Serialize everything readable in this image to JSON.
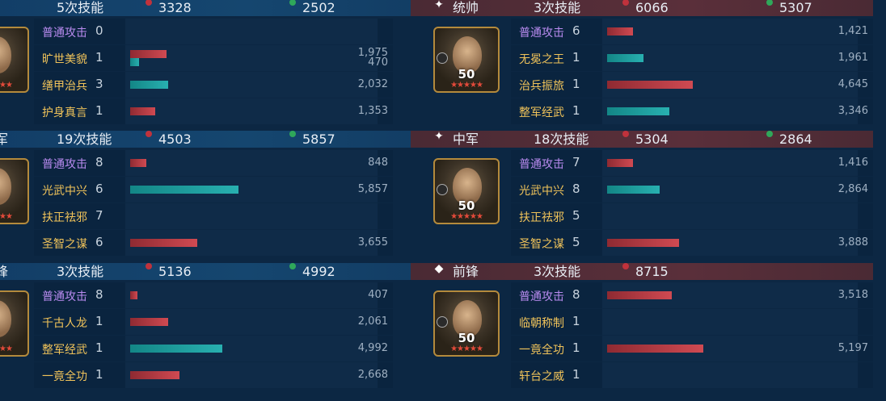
{
  "panels": [
    {
      "id": "left-1",
      "header_style": "blue",
      "position": "",
      "position_icon": "",
      "skill_count": "5次技能",
      "red_total": "3328",
      "green_total": "2502",
      "level": "",
      "skills": [
        {
          "name": "普通攻击",
          "count": "0",
          "kind": "purple",
          "red": null,
          "teal": null
        },
        {
          "name": "旷世美貌",
          "count": "1",
          "kind": "gold",
          "red": "1,975",
          "teal": "470",
          "red_frac": 0.15,
          "teal_frac": 0.036
        },
        {
          "name": "缮甲治兵",
          "count": "3",
          "kind": "gold",
          "red": null,
          "teal": "2,032",
          "teal_frac": 0.155
        },
        {
          "name": "护身真言",
          "count": "1",
          "kind": "gold",
          "red": "1,353",
          "teal": null,
          "red_frac": 0.103
        }
      ]
    },
    {
      "id": "left-2",
      "header_style": "blue",
      "position": "军",
      "position_icon": "",
      "skill_count": "19次技能",
      "red_total": "4503",
      "green_total": "5857",
      "level": "",
      "skills": [
        {
          "name": "普通攻击",
          "count": "8",
          "kind": "purple",
          "red": "848",
          "teal": null,
          "red_frac": 0.065
        },
        {
          "name": "光武中兴",
          "count": "6",
          "kind": "gold",
          "red": null,
          "teal": "5,857",
          "teal_frac": 0.446
        },
        {
          "name": "扶正祛邪",
          "count": "7",
          "kind": "gold",
          "red": null,
          "teal": null
        },
        {
          "name": "圣智之谋",
          "count": "6",
          "kind": "gold",
          "red": "3,655",
          "teal": null,
          "red_frac": 0.278
        }
      ]
    },
    {
      "id": "left-3",
      "header_style": "blue",
      "position": "锋",
      "position_icon": "",
      "skill_count": "3次技能",
      "red_total": "5136",
      "green_total": "4992",
      "level": "",
      "skills": [
        {
          "name": "普通攻击",
          "count": "8",
          "kind": "purple",
          "red": "407",
          "teal": null,
          "red_frac": 0.031
        },
        {
          "name": "千古人龙",
          "count": "1",
          "kind": "gold",
          "red": "2,061",
          "teal": null,
          "red_frac": 0.157
        },
        {
          "name": "整军经武",
          "count": "1",
          "kind": "gold",
          "red": null,
          "teal": "4,992",
          "teal_frac": 0.38
        },
        {
          "name": "一竟全功",
          "count": "1",
          "kind": "gold",
          "red": "2,668",
          "teal": null,
          "red_frac": 0.203
        }
      ]
    },
    {
      "id": "right-1",
      "header_style": "red",
      "position": "统帅",
      "position_icon": "✦",
      "skill_count": "3次技能",
      "red_total": "6066",
      "green_total": "5307",
      "level": "50",
      "skills": [
        {
          "name": "普通攻击",
          "count": "6",
          "kind": "purple",
          "red": "1,421",
          "teal": null,
          "red_frac": 0.108
        },
        {
          "name": "无冕之王",
          "count": "1",
          "kind": "gold",
          "red": null,
          "teal": "1,961",
          "teal_frac": 0.149
        },
        {
          "name": "治兵振旅",
          "count": "1",
          "kind": "gold",
          "red": "4,645",
          "teal": null,
          "red_frac": 0.354
        },
        {
          "name": "整军经武",
          "count": "1",
          "kind": "gold",
          "red": null,
          "teal": "3,346",
          "teal_frac": 0.255
        }
      ]
    },
    {
      "id": "right-2",
      "header_style": "red",
      "position": "中军",
      "position_icon": "✦",
      "skill_count": "18次技能",
      "red_total": "5304",
      "green_total": "2864",
      "level": "50",
      "skills": [
        {
          "name": "普通攻击",
          "count": "7",
          "kind": "purple",
          "red": "1,416",
          "teal": null,
          "red_frac": 0.108
        },
        {
          "name": "光武中兴",
          "count": "8",
          "kind": "gold",
          "red": null,
          "teal": "2,864",
          "teal_frac": 0.218
        },
        {
          "name": "扶正祛邪",
          "count": "5",
          "kind": "gold",
          "red": null,
          "teal": null
        },
        {
          "name": "圣智之谋",
          "count": "5",
          "kind": "gold",
          "red": "3,888",
          "teal": null,
          "red_frac": 0.296
        }
      ]
    },
    {
      "id": "right-3",
      "header_style": "red",
      "position": "前锋",
      "position_icon": "◆",
      "skill_count": "3次技能",
      "red_total": "8715",
      "green_total": "",
      "level": "50",
      "skills": [
        {
          "name": "普通攻击",
          "count": "8",
          "kind": "purple",
          "red": "3,518",
          "teal": null,
          "red_frac": 0.268
        },
        {
          "name": "临朝称制",
          "count": "1",
          "kind": "gold",
          "red": null,
          "teal": null
        },
        {
          "name": "一竟全功",
          "count": "1",
          "kind": "gold",
          "red": "5,197",
          "teal": null,
          "red_frac": 0.396
        },
        {
          "name": "轩台之威",
          "count": "1",
          "kind": "gold",
          "red": null,
          "teal": null
        }
      ]
    }
  ],
  "stars": "★★★★★",
  "colors": {
    "damage": "#c0323c",
    "heal": "#2fa85a",
    "skill_gold": "#f0c35a",
    "skill_purple": "#b98bf0"
  }
}
